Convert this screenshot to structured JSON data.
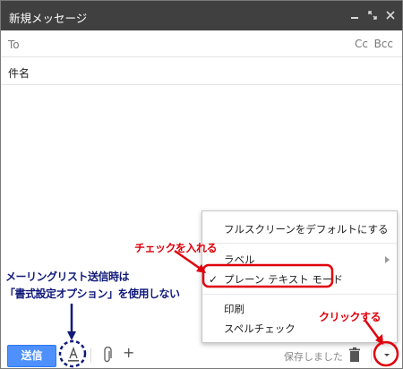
{
  "window": {
    "title": "新規メッセージ"
  },
  "recipients": {
    "to_label": "To",
    "cc_label": "Cc",
    "bcc_label": "Bcc"
  },
  "subject": {
    "placeholder": "件名"
  },
  "menu": {
    "items": [
      {
        "label": "フルスクリーンをデフォルトにする"
      },
      {
        "label": "ラベル"
      },
      {
        "label": "プレーン テキスト モード",
        "checked": true
      },
      {
        "label": "印刷"
      },
      {
        "label": "スペルチェック"
      }
    ]
  },
  "bottom_bar": {
    "send_label": "送信",
    "status": "保存しました"
  },
  "annotations": {
    "check_note": "チェックを入れる",
    "click_note": "クリックする",
    "mailing_note_line1": "メーリングリスト送信時は",
    "mailing_note_line2": "「書式設定オプション」を使用しない"
  },
  "colors": {
    "title_bar": "#404040",
    "send_button": "#4d90fe",
    "annotation_red": "#e0000b",
    "annotation_navy": "#111a7a"
  }
}
